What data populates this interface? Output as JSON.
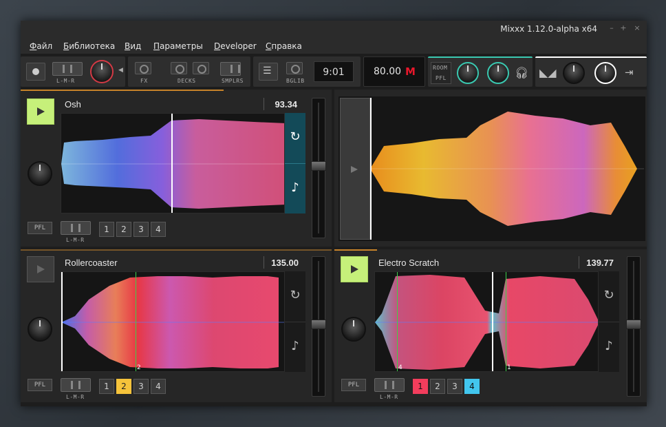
{
  "window": {
    "title": "Mixxx 1.12.0-alpha x64",
    "controls": [
      "–",
      "+",
      "×"
    ]
  },
  "menu": [
    {
      "u": "Ф",
      "rest": "айл"
    },
    {
      "u": "Б",
      "rest": "иблиотека"
    },
    {
      "u": "В",
      "rest": "ид"
    },
    {
      "u": "П",
      "rest": "араметры"
    },
    {
      "u": "D",
      "rest": "eveloper"
    },
    {
      "u": "С",
      "rest": "правка"
    }
  ],
  "toolbar": {
    "lmr_label": "L-M-R",
    "fx_label": "FX",
    "decks_label": "DECKS",
    "smplrs_label": "SMPLRS",
    "bglib_label": "BGLIB",
    "clock": "9:01",
    "master_bpm": "80.00",
    "master_indicator": "M",
    "room_label": "ROOM",
    "pfl_label": "PFL"
  },
  "decks": [
    {
      "title": "Osh",
      "bpm": "93.34",
      "playing": true,
      "pfl_label": "PFL",
      "lmr_label": "L-M-R",
      "hotcues": [
        "1",
        "2",
        "3",
        "4"
      ],
      "active_hotcue": null,
      "fader_level": 0.65
    },
    {
      "title": "Rollercoaster",
      "bpm": "135.00",
      "playing": false,
      "pfl_label": "PFL",
      "lmr_label": "L-M-R",
      "hotcues": [
        "1",
        "2",
        "3",
        "4"
      ],
      "active_hotcue": "2",
      "marker": "2",
      "fader_level": 0.6
    },
    {
      "title": "Electro Scratch",
      "bpm": "139.77",
      "playing": true,
      "pfl_label": "PFL",
      "lmr_label": "L-M-R",
      "hotcues": [
        "1",
        "2",
        "3",
        "4"
      ],
      "active_hotcues": [
        "1",
        "4"
      ],
      "markers": [
        "4",
        "1"
      ],
      "fader_level": 0.6
    }
  ],
  "sampler": {
    "playing": false
  },
  "icons": {
    "sync": "sync-icon",
    "key": "music-note-icon",
    "play": "play-icon",
    "headphones": "headphones-icon",
    "eq": "eq-icon"
  },
  "colors": {
    "accent": "#c8842a",
    "play_active": "#c6f07a",
    "master_m": "#e8172b",
    "hotcue_yellow": "#f5c33b",
    "hotcue_red": "#f23d5c",
    "hotcue_cyan": "#42c6ee",
    "sync_active": "#134a58",
    "knob_ring_red": "#d43a45",
    "knob_ring_teal": "#3ac9b1"
  }
}
